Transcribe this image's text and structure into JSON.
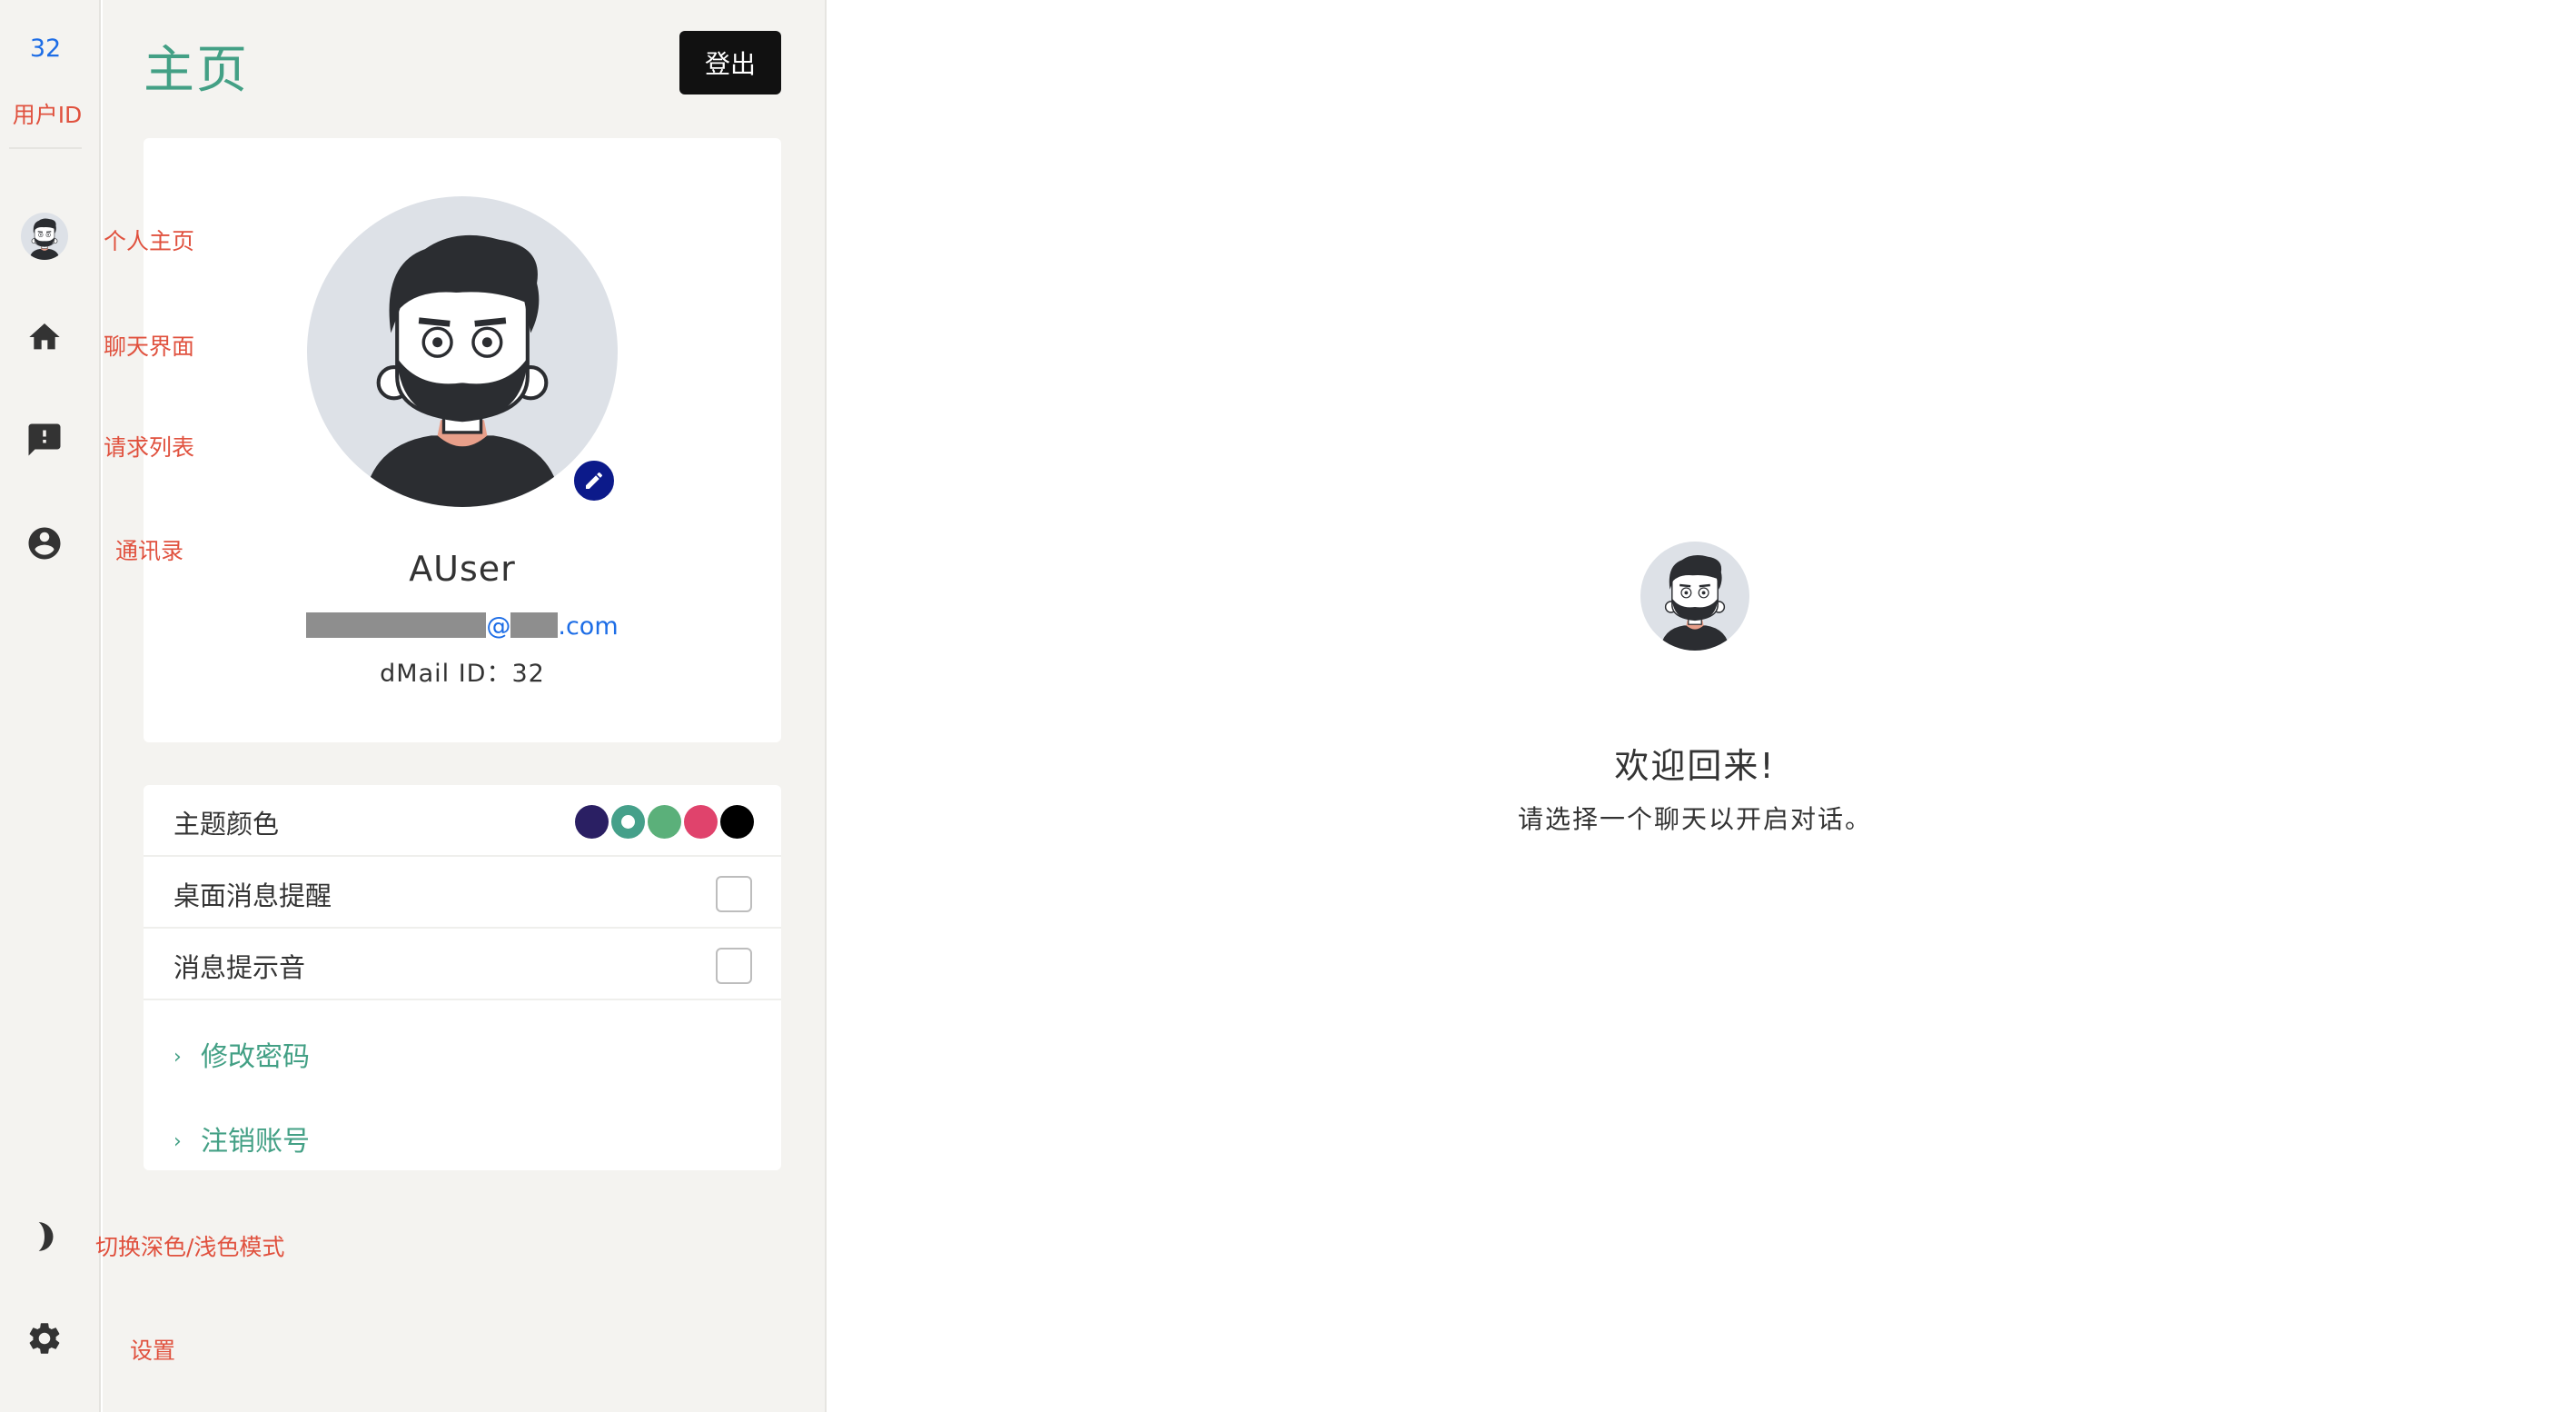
{
  "rail": {
    "user_id": "32",
    "user_id_label": "用户ID",
    "items": [
      {
        "icon": "avatar-icon",
        "annotation": "个人主页"
      },
      {
        "icon": "home-icon",
        "annotation": "聊天界面"
      },
      {
        "icon": "feedback-icon",
        "annotation": "请求列表"
      },
      {
        "icon": "account-circle-icon",
        "annotation": "通讯录"
      }
    ],
    "bottom_items": [
      {
        "icon": "half-moon-icon",
        "annotation": "切换深色/浅色模式"
      },
      {
        "icon": "gear-icon",
        "annotation": "设置"
      }
    ]
  },
  "panel": {
    "title": "主页",
    "logout_label": "登出",
    "profile": {
      "username": "AUser",
      "email_at": "@",
      "email_domain_suffix": ".com",
      "dmail_id": "dMail ID：32"
    },
    "settings": {
      "theme_label": "主题颜色",
      "theme_colors": [
        "#2a1f63",
        "#45a08a",
        "#5bb07a",
        "#e0436c",
        "#000000"
      ],
      "theme_selected_index": 1,
      "desktop_notify_label": "桌面消息提醒",
      "desktop_notify_checked": false,
      "sound_label": "消息提示音",
      "sound_checked": false,
      "change_password_label": "修改密码",
      "delete_account_label": "注销账号"
    }
  },
  "main": {
    "welcome_title": "欢迎回来!",
    "welcome_subtitle": "请选择一个聊天以开启对话。"
  }
}
